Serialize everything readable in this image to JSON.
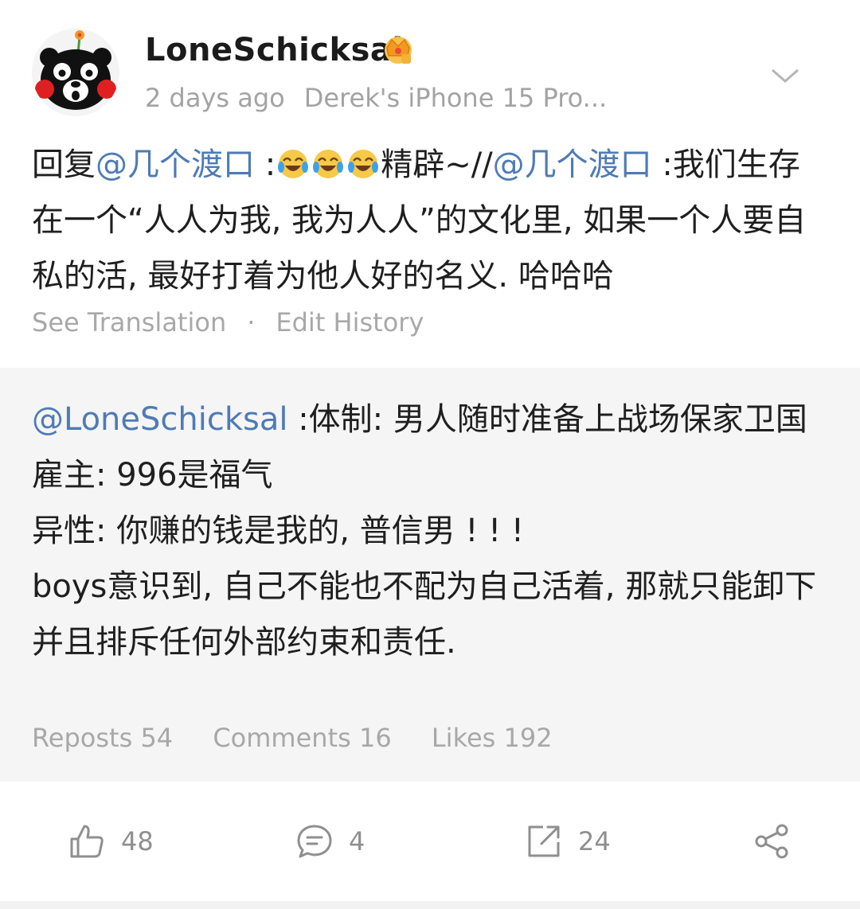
{
  "header": {
    "username": "LoneSchicksal",
    "time": "2 days ago",
    "device": "Derek's iPhone 15 Pro..."
  },
  "post": {
    "prefix": "回复",
    "mention1": "@几个渡口",
    "sep1": " :",
    "text1": "精辟~//",
    "mention2": "@几个渡口",
    "text2": " :我们生存在一个“人人为我, 我为人人”的文化里, 如果一个人要自私的活, 最好打着为他人好的名义. 哈哈哈",
    "see_translation": "See Translation",
    "separator": "·",
    "edit_history": "Edit History"
  },
  "quote": {
    "mention": "@LoneSchicksal",
    "line1": " :体制: 男人随时准备上战场保家卫国",
    "line2": "雇主: 996是福气",
    "line3": "异性: 你赚的钱是我的, 普信男 ! ! !",
    "line4": "boys意识到, 自己不能也不配为自己活着, 那就只能卸下并且排斥任何外部约束和责任.",
    "reposts": "Reposts 54",
    "comments": "Comments 16",
    "likes": "Likes 192"
  },
  "action_bar": {
    "like_count": "48",
    "comment_count": "4",
    "repost_count": "24"
  },
  "icons": {
    "avatar": "kumamon-avatar-icon",
    "badge": "crown-badge-icon",
    "expand": "chevron-down-icon",
    "emoji": "laugh-cry-emoji-icon",
    "like": "thumbs-up-icon",
    "comment": "comment-bubble-icon",
    "repost": "repost-share-icon",
    "share": "share-nodes-icon"
  },
  "colors": {
    "mention": "#4f7bb5",
    "secondary_text": "#a3a3a3",
    "quote_background": "#f5f5f5"
  }
}
